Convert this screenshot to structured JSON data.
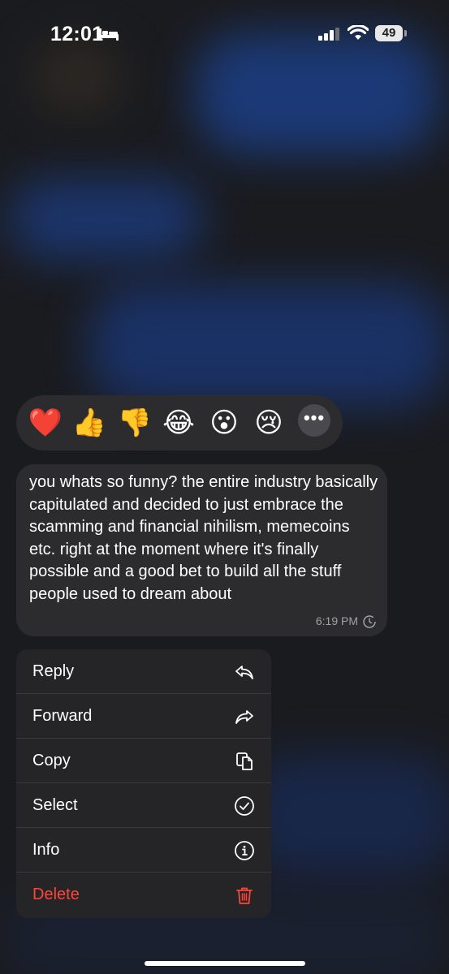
{
  "status_bar": {
    "time": "12:01",
    "battery": "49",
    "icons": [
      "bed-icon",
      "signal-bars-icon",
      "wifi-icon",
      "battery-icon"
    ]
  },
  "reactions": {
    "items": [
      {
        "name": "heart",
        "glyph": "❤️"
      },
      {
        "name": "thumbs-up",
        "glyph": "👍"
      },
      {
        "name": "thumbs-down",
        "glyph": "👎"
      },
      {
        "name": "laughing",
        "glyph": "😂"
      },
      {
        "name": "surprised",
        "glyph": "😮"
      },
      {
        "name": "crying",
        "glyph": "😢"
      }
    ],
    "more_glyph": "•••"
  },
  "message": {
    "text": "you whats so funny? the entire industry basically capitulated and decided to just embrace the scamming and financial nihilism, memecoins etc. right at the moment where it's finally possible and a good bet to build all the stuff people used to dream about",
    "time": "6:19 PM",
    "status_icon": "timer-icon"
  },
  "menu": {
    "items": [
      {
        "label": "Reply",
        "icon": "reply-icon"
      },
      {
        "label": "Forward",
        "icon": "forward-icon"
      },
      {
        "label": "Copy",
        "icon": "copy-icon"
      },
      {
        "label": "Select",
        "icon": "checkmark-circle-icon"
      },
      {
        "label": "Info",
        "icon": "info-circle-icon"
      },
      {
        "label": "Delete",
        "icon": "trash-icon"
      }
    ]
  },
  "colors": {
    "background": "#1b1c20",
    "surface": "#2c2c2e",
    "menu": "#252527",
    "destructive": "#ff453a",
    "secondary_text": "#a1a1a6"
  }
}
